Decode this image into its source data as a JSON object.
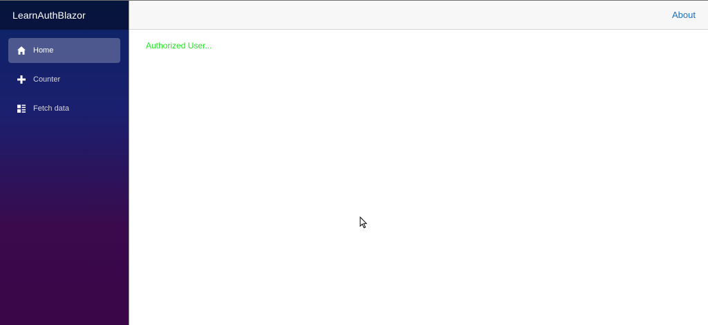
{
  "app": {
    "brand": "LearnAuthBlazor"
  },
  "sidebar": {
    "items": [
      {
        "label": "Home",
        "icon": "home-icon",
        "active": true
      },
      {
        "label": "Counter",
        "icon": "plus-icon",
        "active": false
      },
      {
        "label": "Fetch data",
        "icon": "list-icon",
        "active": false
      }
    ]
  },
  "header": {
    "about_label": "About"
  },
  "main": {
    "status_text": "Authorized User..."
  },
  "colors": {
    "sidebar_top": "#0b2365",
    "sidebar_bottom": "#3a0647",
    "link": "#1b6ec2",
    "status_text": "#22e522"
  }
}
